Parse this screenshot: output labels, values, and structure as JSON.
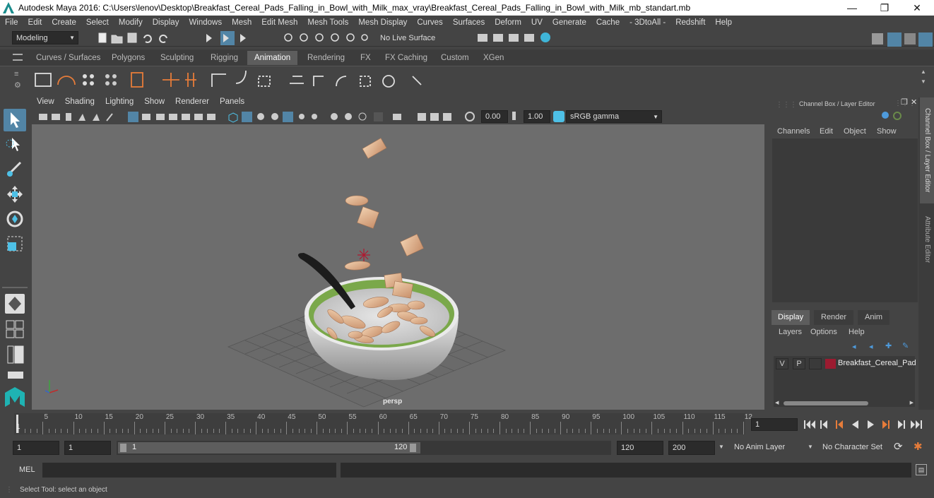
{
  "window": {
    "title": "Autodesk Maya 2016: C:\\Users\\lenov\\Desktop\\Breakfast_Cereal_Pads_Falling_in_Bowl_with_Milk_max_vray\\Breakfast_Cereal_Pads_Falling_in_Bowl_with_Milk_mb_standart.mb",
    "minimize": "—",
    "restore": "❐",
    "close": "✕"
  },
  "menubar": [
    "File",
    "Edit",
    "Create",
    "Select",
    "Modify",
    "Display",
    "Windows",
    "Mesh",
    "Edit Mesh",
    "Mesh Tools",
    "Mesh Display",
    "Curves",
    "Surfaces",
    "Deform",
    "UV",
    "Generate",
    "Cache",
    "- 3DtoAll -",
    "Redshift",
    "Help"
  ],
  "statusline": {
    "mode_selector": "Modeling",
    "live_surface": "No Live Surface"
  },
  "shelf": {
    "tabs": [
      "Curves / Surfaces",
      "Polygons",
      "Sculpting",
      "Rigging",
      "Animation",
      "Rendering",
      "FX",
      "FX Caching",
      "Custom",
      "XGen"
    ],
    "active_tab": "Animation"
  },
  "viewport": {
    "menus": [
      "View",
      "Shading",
      "Lighting",
      "Show",
      "Renderer",
      "Panels"
    ],
    "exposure": "0.00",
    "gamma": "1.00",
    "color_space": "sRGB gamma",
    "camera_label": "persp"
  },
  "channel_box": {
    "title": "Channel Box / Layer Editor",
    "menus": [
      "Channels",
      "Edit",
      "Object",
      "Show"
    ]
  },
  "layer_editor": {
    "tabs": [
      "Display",
      "Render",
      "Anim"
    ],
    "active_tab": "Display",
    "menus": [
      "Layers",
      "Options",
      "Help"
    ],
    "layers": [
      {
        "visible": "V",
        "playback": "P",
        "color": "#9b1b30",
        "name": "Breakfast_Cereal_Pads"
      }
    ]
  },
  "side_tabs": [
    "Channel Box / Layer Editor",
    "Attribute Editor"
  ],
  "timeline": {
    "ticks": [
      "5",
      "10",
      "15",
      "20",
      "25",
      "30",
      "35",
      "40",
      "45",
      "50",
      "55",
      "60",
      "65",
      "70",
      "75",
      "80",
      "85",
      "90",
      "95",
      "100",
      "105",
      "110",
      "115",
      "12"
    ],
    "start_marker": "1",
    "current_frame": "1"
  },
  "playback_buttons": [
    "go-to-start",
    "step-back-key",
    "step-back-frame",
    "play-back",
    "play-forward",
    "step-forward-frame",
    "step-forward-key",
    "go-to-end"
  ],
  "range": {
    "start": "1",
    "playback_start": "1",
    "slider_start": "1",
    "slider_end": "120",
    "playback_end": "120",
    "end": "200",
    "anim_layer": "No Anim Layer",
    "character_set": "No Character Set"
  },
  "cmdline": {
    "label": "MEL"
  },
  "helpline": {
    "text": "Select Tool: select an object"
  },
  "colors": {
    "accent": "#5285a6",
    "active_tab": "#5d5d5d",
    "viewport_bg": "#6d6d6d",
    "layer_color": "#9b1b30"
  }
}
